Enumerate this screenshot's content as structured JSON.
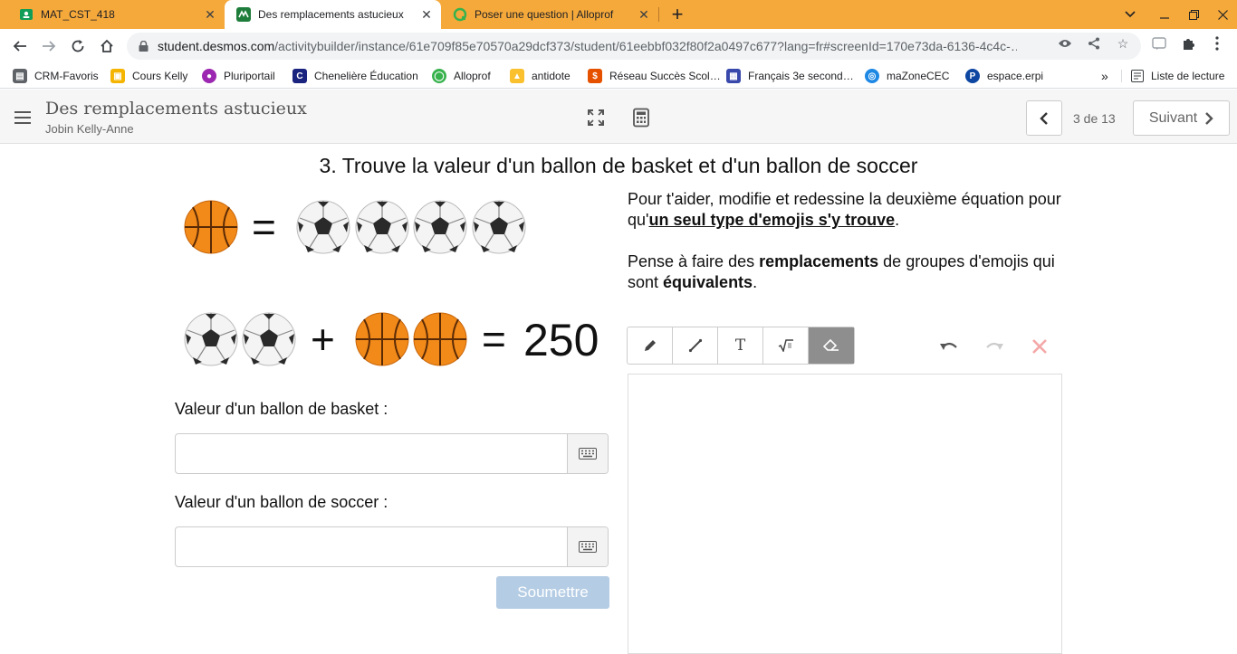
{
  "browser": {
    "tabs": [
      {
        "title": "MAT_CST_418",
        "icon": "classroom-icon",
        "active": false
      },
      {
        "title": "Des remplacements astucieux",
        "icon": "desmos-icon",
        "active": true
      },
      {
        "title": "Poser une question | Alloprof",
        "icon": "alloprof-icon",
        "active": false
      }
    ],
    "url_host": "student.desmos.com",
    "url_path": "/activitybuilder/instance/61e709f85e70570a29dcf373/student/61eebbf032f80f2a0497c677?lang=fr#screenId=170e73da-6136-4c4c-…",
    "bookmarks": [
      {
        "label": "CRM-Favoris",
        "color": "#5f6368",
        "glyph": "▤"
      },
      {
        "label": "Cours Kelly",
        "color": "#f4b400",
        "glyph": "▣"
      },
      {
        "label": "Pluriportail",
        "color": "#9c27b0",
        "glyph": "●"
      },
      {
        "label": "Chenelière Éducation",
        "color": "#1a237e",
        "glyph": "C"
      },
      {
        "label": "Alloprof",
        "color": "#37b24d",
        "glyph": "◯"
      },
      {
        "label": "antidote",
        "color": "#fbc02d",
        "glyph": "▲"
      },
      {
        "label": "Réseau Succès Scol…",
        "color": "#e65100",
        "glyph": "$"
      },
      {
        "label": "Français 3e second…",
        "color": "#3949ab",
        "glyph": "▦"
      },
      {
        "label": "maZoneCEC",
        "color": "#1e88e5",
        "glyph": "◎"
      },
      {
        "label": "espace.erpi",
        "color": "#0d47a1",
        "glyph": "P"
      }
    ],
    "more_bookmarks": "»",
    "reading_list": "Liste de lecture"
  },
  "header": {
    "activity_title": "Des remplacements astucieux",
    "student_name": "Jobin Kelly-Anne",
    "pager": "3 de 13",
    "next_label": "Suivant"
  },
  "question": {
    "title": "3. Trouve la valeur d'un ballon de basket et d'un ballon de soccer",
    "eq1_sign": "=",
    "eq2_plus": "+",
    "eq2_sign": "=",
    "eq2_value": "250",
    "label_basket": "Valeur d'un ballon de basket :",
    "label_soccer": "Valeur d'un ballon de soccer :",
    "submit_label": "Soumettre",
    "instr1_pre": "Pour t'aider, modifie et redessine la deuxième équation pour qu'",
    "instr1_bold": "un seul type d'emojis s'y trouve",
    "instr1_post": ".",
    "instr2_pre": "Pense à faire des ",
    "instr2_bold1": "remplacements",
    "instr2_mid": " de groupes d'emojis qui sont ",
    "instr2_bold2": "équivalents",
    "instr2_post": "."
  },
  "sketch": {
    "tools": [
      "pencil-icon",
      "line-icon",
      "text-icon",
      "math-icon",
      "eraser-icon"
    ],
    "text_tool_glyph": "T",
    "active_tool": "eraser-icon"
  }
}
